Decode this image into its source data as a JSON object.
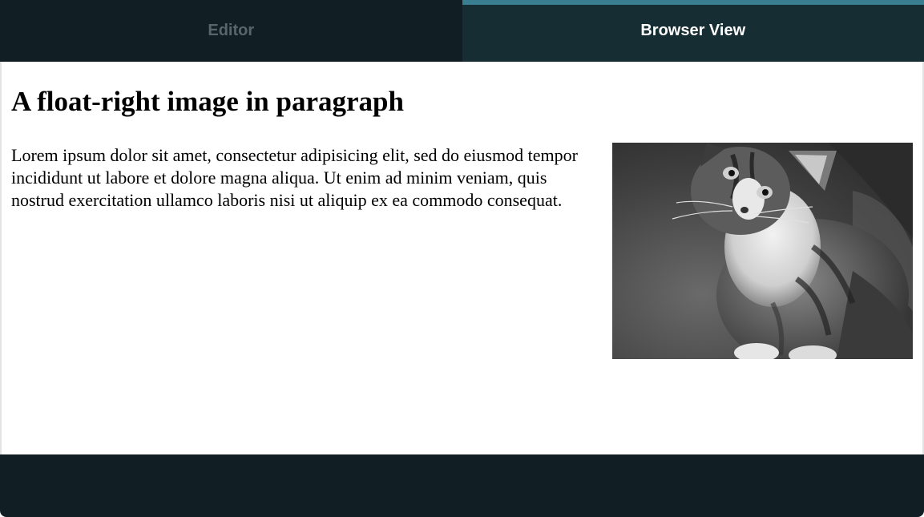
{
  "tabs": [
    {
      "label": "Editor",
      "active": false
    },
    {
      "label": "Browser View",
      "active": true
    }
  ],
  "page": {
    "title": "A float-right image in paragraph",
    "paragraph": "Lorem ipsum dolor sit amet, consectetur adipisicing elit, sed do eiusmod tempor incididunt ut labore et dolore magna aliqua. Ut enim ad minim veniam, quis nostrud exercitation ullamco laboris nisi ut aliquip ex ea commodo consequat.",
    "image": {
      "subject": "kitten",
      "style": "grayscale photo",
      "float": "right"
    }
  },
  "colors": {
    "tab_bar_bg": "#111f24",
    "active_tab_bg": "#162d34",
    "active_tab_accent": "#3a7f91",
    "inactive_tab_text": "#56666c",
    "footer_bg": "#111f24"
  }
}
